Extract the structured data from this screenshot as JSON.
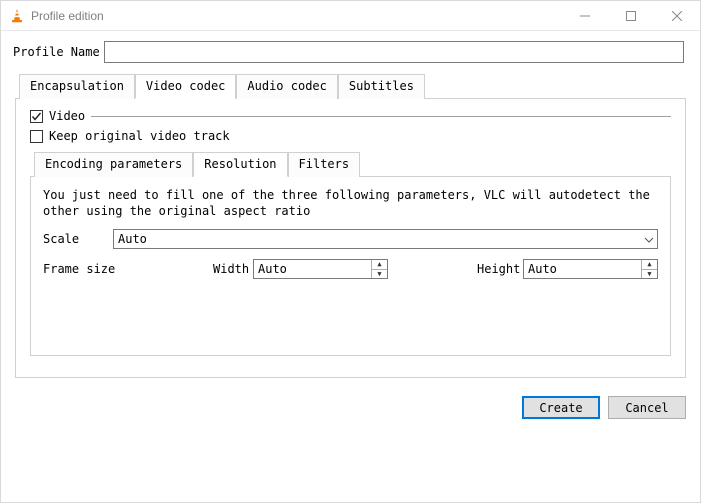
{
  "window": {
    "title": "Profile edition"
  },
  "profile": {
    "label": "Profile Name",
    "value": ""
  },
  "outer_tabs": [
    {
      "label": "Encapsulation",
      "active": false
    },
    {
      "label": "Video codec",
      "active": true
    },
    {
      "label": "Audio codec",
      "active": false
    },
    {
      "label": "Subtitles",
      "active": false
    }
  ],
  "video_codec": {
    "video_label": "Video",
    "video_checked": true,
    "keep_orig_label": "Keep original video track",
    "keep_orig_checked": false,
    "inner_tabs": [
      {
        "label": "Encoding parameters",
        "active": false
      },
      {
        "label": "Resolution",
        "active": true
      },
      {
        "label": "Filters",
        "active": false
      }
    ],
    "resolution": {
      "hint": "You just need to fill one of the three following parameters, VLC will autodetect the other using the original aspect ratio",
      "scale_label": "Scale",
      "scale_value": "Auto",
      "frame_size_label": "Frame size",
      "width_label": "Width",
      "width_value": "Auto",
      "height_label": "Height",
      "height_value": "Auto"
    }
  },
  "buttons": {
    "create": "Create",
    "cancel": "Cancel"
  }
}
